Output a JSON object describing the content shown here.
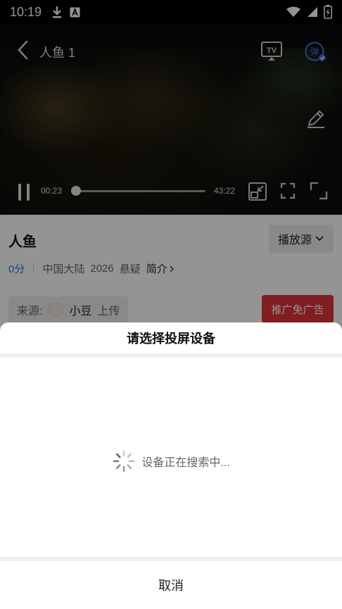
{
  "status_bar": {
    "time": "10:19",
    "left_icons": [
      "download-icon",
      "a-square-icon"
    ],
    "right_icons": [
      "wifi-icon",
      "signal-icon",
      "battery-charging-icon"
    ]
  },
  "player": {
    "title": "人鱼 1",
    "current_time": "00:23",
    "total_time": "43:22",
    "progress_fraction": 0.009,
    "icons": [
      "back-icon",
      "tv-cast-icon",
      "danmu-icon",
      "edit-icon",
      "pause-icon",
      "pip-icon",
      "fit-screen-icon",
      "fullscreen-icon"
    ]
  },
  "info": {
    "movie_title": "人鱼",
    "source_label": "播放源",
    "score": "0分",
    "region": "中国大陆",
    "year": "2026",
    "genre": "悬疑",
    "intro_label": "简介",
    "source_prefix": "来源:",
    "uploader_name": "小豆",
    "uploader_suffix": "上传",
    "promo_label": "推广免广告"
  },
  "cast_sheet": {
    "title": "请选择投屏设备",
    "searching_text": "设备正在搜索中...",
    "cancel_label": "取消"
  },
  "colors": {
    "accent_blue": "#2f6fe0",
    "promo_red": "#e0323c"
  }
}
